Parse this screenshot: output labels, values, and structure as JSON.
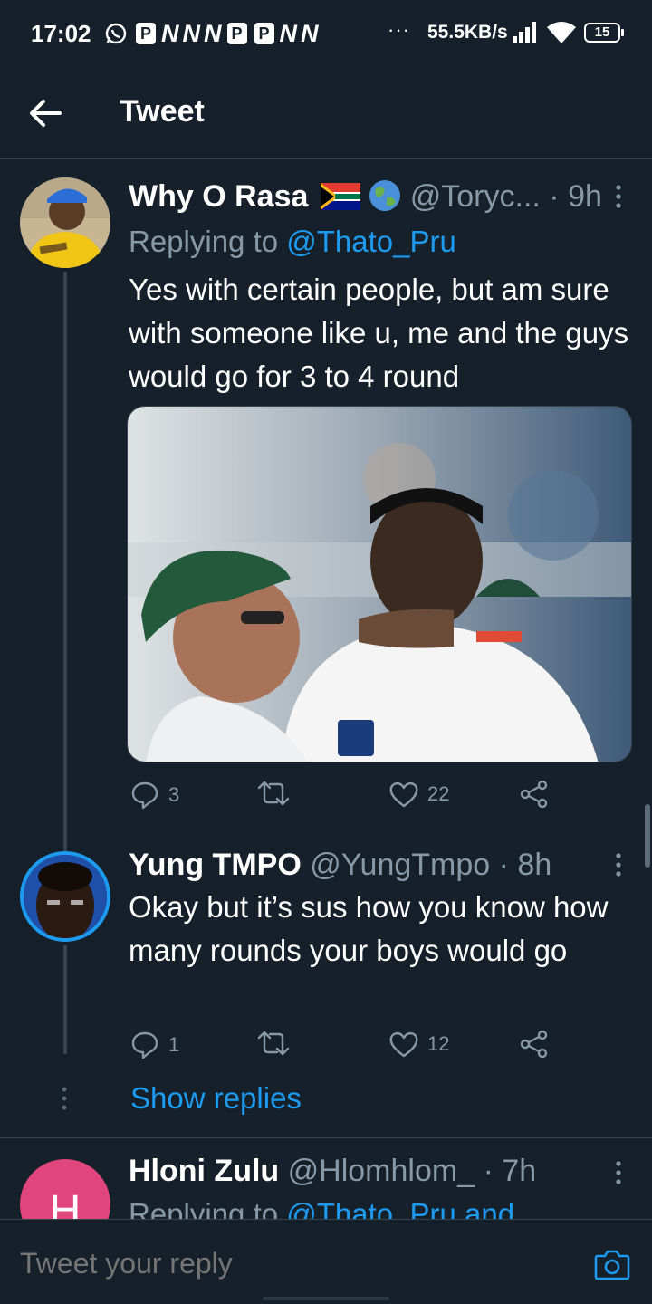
{
  "status_bar": {
    "time": "17:02",
    "app_icons": [
      "P",
      "N",
      "N",
      "N",
      "P",
      "P",
      "N",
      "N"
    ],
    "overflow": "···",
    "net_speed": "55.5KB/s",
    "battery": "15"
  },
  "header": {
    "title": "Tweet"
  },
  "tweets": [
    {
      "name": "Why O Rasa",
      "flags": [
        "south-africa-flag-icon",
        "globe-icon"
      ],
      "handle": "@Toryc...",
      "separator": "·",
      "time": "9h",
      "reply_prefix": "Replying to ",
      "reply_mention": "@Thato_Pru",
      "body": "Yes with certain people, but am sure with someone like u, me and the guys would go for 3 to 4 round",
      "has_media": true,
      "replies": "3",
      "retweets": "",
      "likes": "22"
    },
    {
      "name": "Yung TMPO",
      "handle": "@YungTmpo",
      "separator": "·",
      "time": "8h",
      "body": "Okay but it’s sus how you know how many rounds your boys would go",
      "replies": "1",
      "retweets": "",
      "likes": "12"
    },
    {
      "name": "Hloni Zulu",
      "handle": "@Hlomhlom_",
      "separator": "·",
      "time": "7h",
      "avatar_letter": "H",
      "reply_prefix": "Replying to ",
      "reply_mention": "@Thato_Pru and"
    }
  ],
  "show_replies": "Show replies",
  "reply_bar": {
    "placeholder": "Tweet your reply"
  },
  "colors": {
    "background": "#15202b",
    "accent": "#1d9bf0",
    "secondary_text": "#8899a6",
    "divider": "#38444d",
    "hloni_avatar": "#e0457b"
  }
}
